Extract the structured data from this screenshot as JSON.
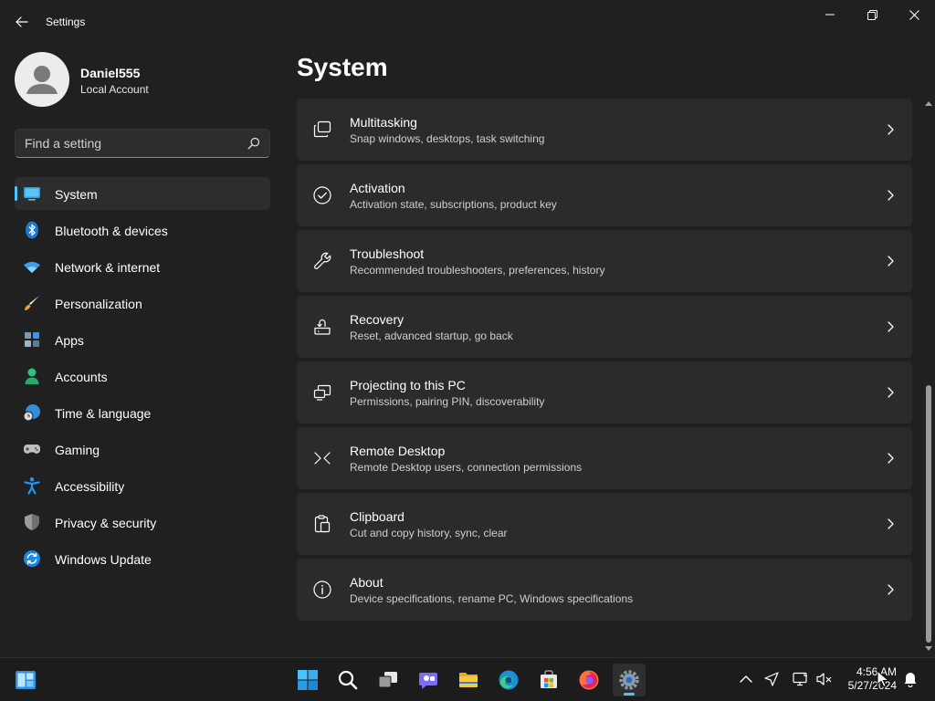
{
  "window": {
    "title": "Settings"
  },
  "profile": {
    "name": "Daniel555",
    "account_type": "Local Account"
  },
  "search": {
    "placeholder": "Find a setting"
  },
  "sidebar": {
    "items": [
      {
        "label": "System",
        "icon": "monitor-icon",
        "selected": true
      },
      {
        "label": "Bluetooth & devices",
        "icon": "bluetooth-icon"
      },
      {
        "label": "Network & internet",
        "icon": "wifi-icon"
      },
      {
        "label": "Personalization",
        "icon": "brush-icon"
      },
      {
        "label": "Apps",
        "icon": "apps-icon"
      },
      {
        "label": "Accounts",
        "icon": "person-icon"
      },
      {
        "label": "Time & language",
        "icon": "globe-clock-icon"
      },
      {
        "label": "Gaming",
        "icon": "gamepad-icon"
      },
      {
        "label": "Accessibility",
        "icon": "accessibility-icon"
      },
      {
        "label": "Privacy & security",
        "icon": "shield-icon"
      },
      {
        "label": "Windows Update",
        "icon": "update-icon"
      }
    ]
  },
  "main": {
    "title": "System",
    "cards": [
      {
        "title": "Multitasking",
        "description": "Snap windows, desktops, task switching",
        "icon": "multitasking-icon"
      },
      {
        "title": "Activation",
        "description": "Activation state, subscriptions, product key",
        "icon": "check-circle-icon"
      },
      {
        "title": "Troubleshoot",
        "description": "Recommended troubleshooters, preferences, history",
        "icon": "wrench-icon"
      },
      {
        "title": "Recovery",
        "description": "Reset, advanced startup, go back",
        "icon": "recovery-icon"
      },
      {
        "title": "Projecting to this PC",
        "description": "Permissions, pairing PIN, discoverability",
        "icon": "projecting-icon"
      },
      {
        "title": "Remote Desktop",
        "description": "Remote Desktop users, connection permissions",
        "icon": "remote-desktop-icon"
      },
      {
        "title": "Clipboard",
        "description": "Cut and copy history, sync, clear",
        "icon": "clipboard-icon"
      },
      {
        "title": "About",
        "description": "Device specifications, rename PC, Windows specifications",
        "icon": "info-icon"
      }
    ]
  },
  "taskbar": {
    "apps": [
      "start-icon",
      "search-icon",
      "task-view-icon",
      "chat-icon",
      "file-explorer-icon",
      "edge-icon",
      "store-icon",
      "firefox-icon",
      "settings-icon"
    ],
    "active_app": "settings-icon",
    "tray": [
      "chevron-up-icon",
      "location-icon",
      "network-icon",
      "volume-muted-icon",
      "notification-icon"
    ],
    "time": "4:56 AM",
    "date": "5/27/2024"
  },
  "colors": {
    "accent": "#4cc2ff",
    "background": "#202020",
    "card": "#2b2b2b",
    "taskbar": "#1c1c1c"
  }
}
